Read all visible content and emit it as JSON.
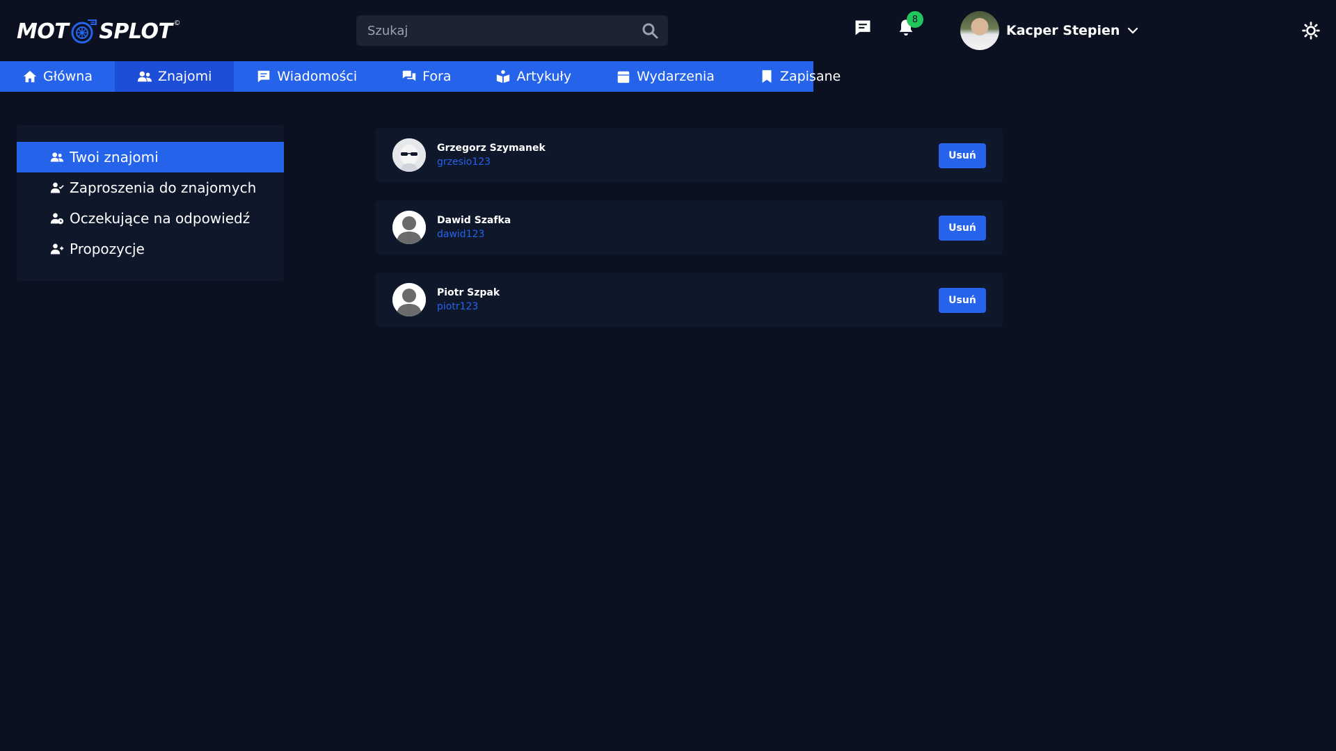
{
  "app": {
    "logo_left": "MOT",
    "logo_right": "SPLOT",
    "logo_mark": "©"
  },
  "header": {
    "search_placeholder": "Szukaj",
    "notifications_count": "8",
    "user_name": "Kacper Stepien"
  },
  "nav": {
    "items": [
      {
        "label": "Główna",
        "icon": "home-icon"
      },
      {
        "label": "Znajomi",
        "icon": "users-icon",
        "active": true
      },
      {
        "label": "Wiadomości",
        "icon": "message-icon"
      },
      {
        "label": "Fora",
        "icon": "forum-icon"
      },
      {
        "label": "Artykuły",
        "icon": "articles-icon"
      },
      {
        "label": "Wydarzenia",
        "icon": "calendar-icon"
      },
      {
        "label": "Zapisane",
        "icon": "bookmark-icon"
      }
    ]
  },
  "sidebar": {
    "items": [
      {
        "label": "Twoi znajomi",
        "icon": "users-icon",
        "active": true
      },
      {
        "label": "Zaproszenia do znajomych",
        "icon": "user-check-icon"
      },
      {
        "label": "Oczekujące na odpowiedź",
        "icon": "user-clock-icon"
      },
      {
        "label": "Propozycje",
        "icon": "user-plus-icon"
      }
    ]
  },
  "friends": [
    {
      "name": "Grzegorz Szymanek",
      "username": "grzesio123",
      "action": "Usuń",
      "avatar": "sunglasses-avatar"
    },
    {
      "name": "Dawid Szafka",
      "username": "dawid123",
      "action": "Usuń",
      "avatar": "default-avatar"
    },
    {
      "name": "Piotr Szpak",
      "username": "piotr123",
      "action": "Usuń",
      "avatar": "default-avatar"
    }
  ],
  "colors": {
    "background": "#0b1121",
    "panel": "#0f172a",
    "accent": "#2563eb",
    "accent_dark": "#1d4ed8",
    "badge": "#22c55e"
  }
}
